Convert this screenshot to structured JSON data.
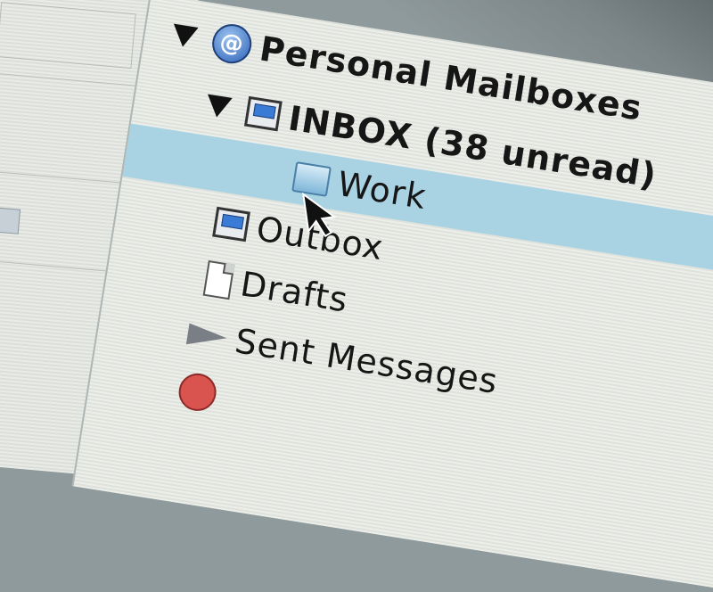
{
  "mailboxes": {
    "group": {
      "label": "Personal Mailboxes",
      "icon": "at-sign-icon"
    },
    "items": [
      {
        "label": "INBOX (38 unread)",
        "icon": "inbox-tray-icon",
        "selected": false
      },
      {
        "label": "Work",
        "icon": "folder-icon",
        "selected": true
      },
      {
        "label": "Outbox",
        "icon": "outbox-tray-icon",
        "selected": false
      },
      {
        "label": "Drafts",
        "icon": "document-icon",
        "selected": false
      },
      {
        "label": "Sent Messages",
        "icon": "paper-plane-icon",
        "selected": false
      }
    ]
  },
  "colors": {
    "selection": "#a9d3e3",
    "text": "#161616",
    "panel": "#eceee9"
  }
}
